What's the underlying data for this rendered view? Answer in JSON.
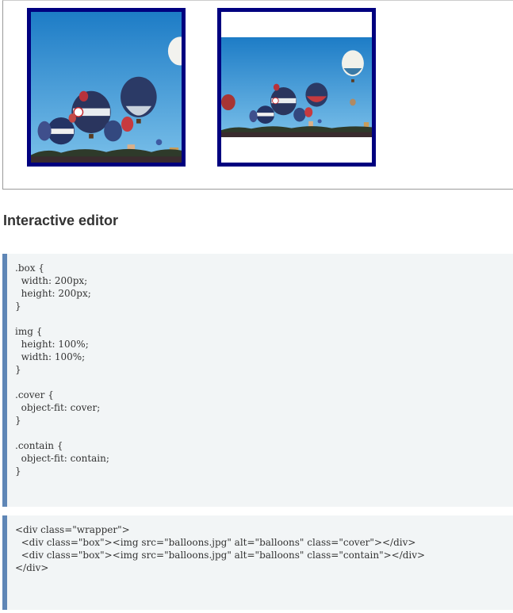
{
  "preview": {
    "images": [
      {
        "class": "cover",
        "alt": "balloons",
        "fit": "cover"
      },
      {
        "class": "contain",
        "alt": "balloons",
        "fit": "contain"
      }
    ],
    "frame_color": "#00007f"
  },
  "heading": "Interactive editor",
  "css_editor": {
    "lines": [
      ".box {",
      "  width: 200px;",
      "  height: 200px;",
      "}",
      "",
      "img {",
      "  height: 100%;",
      "  width: 100%;",
      "}",
      "",
      ".cover {",
      "  object-fit: cover;",
      "}",
      "",
      ".contain {",
      "  object-fit: contain;",
      "}"
    ]
  },
  "html_editor": {
    "lines": [
      "<div class=\"wrapper\">",
      "  <div class=\"box\"><img src=\"balloons.jpg\" alt=\"balloons\" class=\"cover\"></div>",
      "  <div class=\"box\"><img src=\"balloons.jpg\" alt=\"balloons\" class=\"contain\"></div>",
      "</div>"
    ]
  },
  "colors": {
    "accent_border": "#5f86b6",
    "code_background": "#f2f5f6",
    "sky_top": "#1d7cc6",
    "sky_bottom": "#6fb8e6"
  }
}
